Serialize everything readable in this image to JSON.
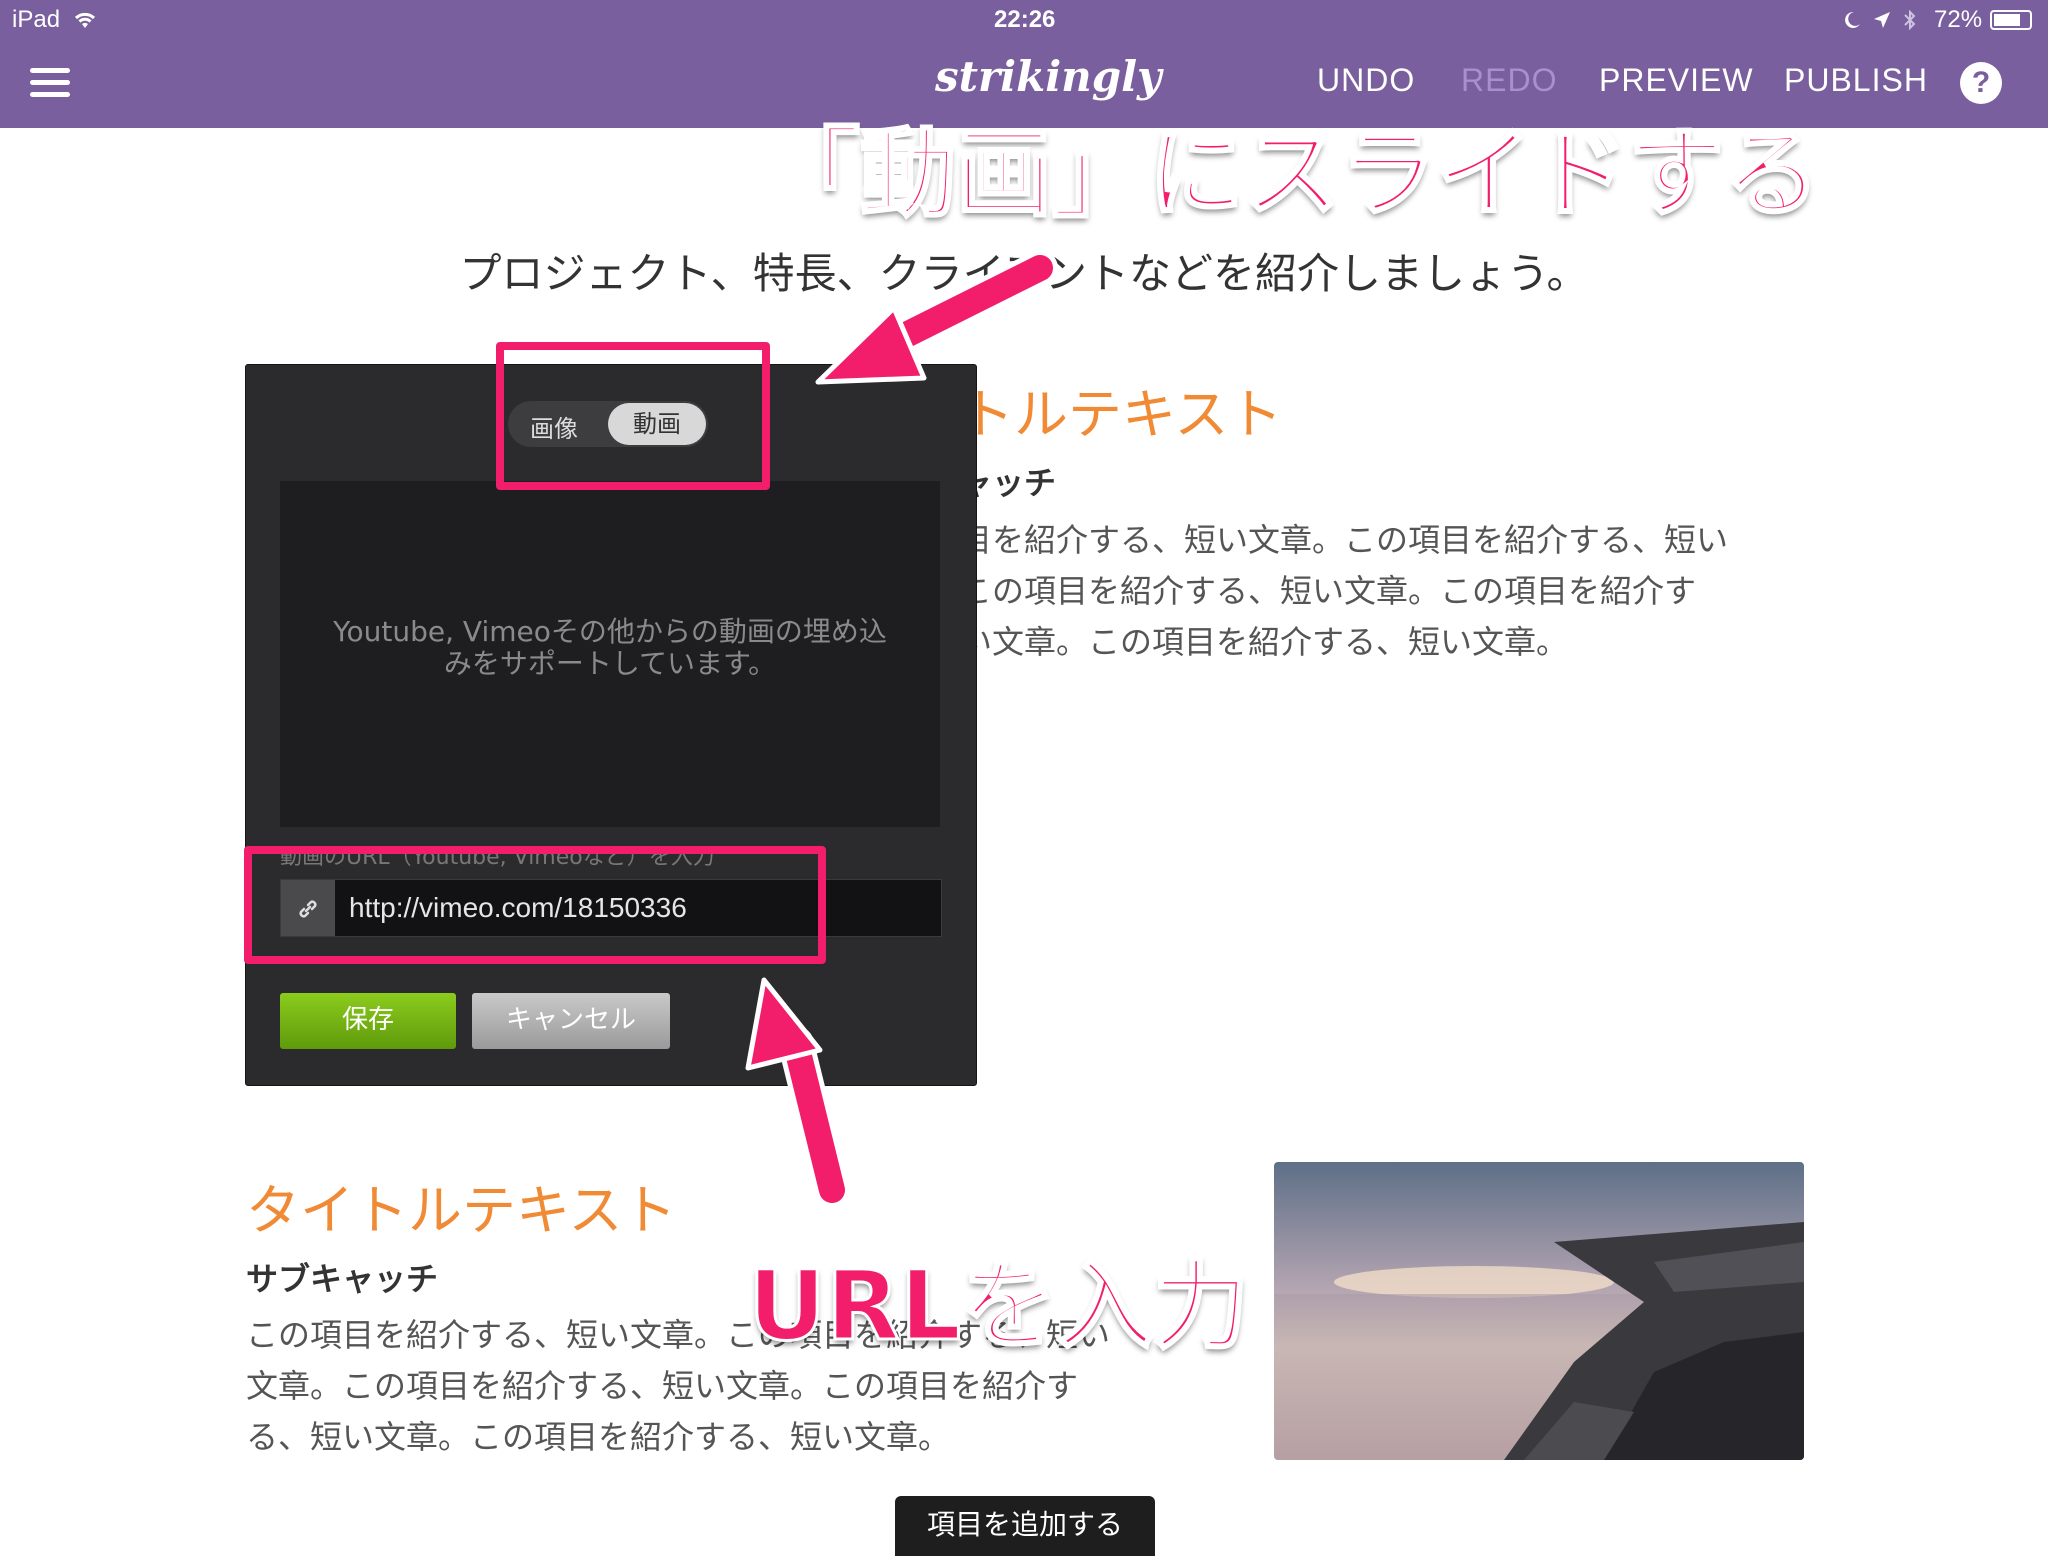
{
  "status_bar": {
    "device": "iPad",
    "time": "22:26",
    "battery": "72%"
  },
  "app_bar": {
    "brand": "strikingly",
    "undo": "UNDO",
    "redo": "REDO",
    "preview": "PREVIEW",
    "publish": "PUBLISH",
    "help": "?"
  },
  "section": {
    "intro": "プロジェクト、特長、クライアントなどを紹介しましょう。",
    "item1": {
      "title_partial": "トルテキスト",
      "subcatch_partial": "ャッチ",
      "body_lines": [
        "目を紹介する、短い文章。この項目を紹介する、短い",
        "この項目を紹介する、短い文章。この項目を紹介す",
        "い文章。この項目を紹介する、短い文章。"
      ]
    },
    "item2": {
      "title": "タイトルテキスト",
      "subcatch": "サブキャッチ",
      "body_lines": [
        "この項目を紹介する、短い文章。この項目を紹介する、短い",
        "文章。この項目を紹介する、短い文章。この項目を紹介す",
        "る、短い文章。この項目を紹介する、短い文章。"
      ]
    },
    "add_item": "項目を追加する"
  },
  "dialog": {
    "toggle_image": "画像",
    "toggle_video": "動画",
    "preview_text": "Youtube, Vimeoその他からの動画の埋め込みをサポートしています。",
    "url_label": "動画のURL（Youtube, Vimeoなど）を入力",
    "url_value": "http://vimeo.com/18150336",
    "save": "保存",
    "cancel": "キャンセル"
  },
  "annotations": {
    "top": "「動画」にスライドする",
    "bottom": "URLを入力"
  },
  "colors": {
    "app_bar": "#7a5f9e",
    "accent_orange": "#f08a35",
    "annotation_pink": "#f21d6b",
    "save_green": "#6fae12"
  }
}
